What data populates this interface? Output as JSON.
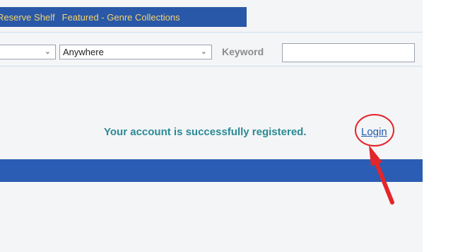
{
  "nav": {
    "items": [
      {
        "label": "Reserve Shelf"
      },
      {
        "label": "Featured - Genre Collections"
      }
    ]
  },
  "search": {
    "field_select": {
      "value": "",
      "icon": "chevron-down-icon"
    },
    "scope_select": {
      "value": "Anywhere",
      "icon": "chevron-down-icon"
    },
    "keyword_label": "Keyword",
    "keyword_value": ""
  },
  "message": {
    "text": "Your account is successfully registered.",
    "login_label": "Login"
  },
  "annotation": {
    "color": "#e3262b",
    "shapes": [
      "circle",
      "arrow"
    ]
  },
  "colors": {
    "nav_bg": "#2a58a8",
    "nav_text": "#f3d36b",
    "message_text": "#2a8a94",
    "link": "#1f5bb0",
    "bar": "#2a5db3"
  }
}
